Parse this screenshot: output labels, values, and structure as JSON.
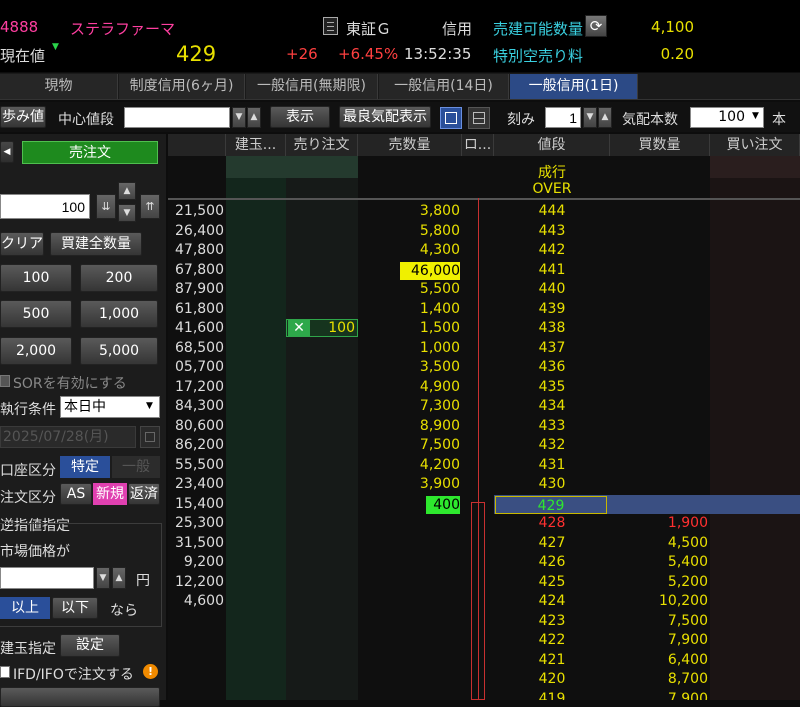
{
  "header": {
    "code": "4888",
    "name": "ステラファーマ",
    "price_label": "現在値",
    "price": "429",
    "change": "+26",
    "change_pct": "+6.45%",
    "time": "13:52:35",
    "market_icon_name": "document-icon",
    "market": "東証Ｇ",
    "margin": "信用",
    "sell_qty_label": "売建可能数量",
    "sell_qty": "4,100",
    "short_fee_label": "特別空売り料",
    "short_fee": "0.20"
  },
  "tabs": [
    "現物",
    "制度信用(6ヶ月)",
    "一般信用(無期限)",
    "一般信用(14日)",
    "一般信用(1日)"
  ],
  "controls": {
    "step_btn": "歩み値",
    "center_label": "中心値段",
    "center_value": "",
    "display_btn": "表示",
    "best_btn": "最良気配表示",
    "tick_label": "刻み",
    "tick_value": "1",
    "quote_label": "気配本数",
    "quote_value": "100",
    "quote_unit": "本"
  },
  "panel": {
    "sell_btn": "売注文",
    "qty": "100",
    "clear_btn": "クリア",
    "buy_all_btn": "買建全数量",
    "qty_buttons": [
      "100",
      "200",
      "500",
      "1,000",
      "2,000",
      "5,000"
    ],
    "sor_label": "SORを有効にする",
    "exec_label": "執行条件",
    "exec_value": "本日中",
    "date_value": "2025/07/28(月)",
    "account_label": "口座区分",
    "account_tokutei": "特定",
    "account_ippan": "一般",
    "order_label": "注文区分",
    "order_as": "AS",
    "order_new": "新規",
    "order_close": "返済",
    "stop_label": "逆指値指定",
    "market_price_label": "市場価格が",
    "yen": "円",
    "above_btn": "以上",
    "below_btn": "以下",
    "nara": "なら",
    "position_label": "建玉指定",
    "setting_btn": "設定",
    "ifd_label": "IFD/IFOで注文する",
    "warn_icon": "!"
  },
  "colors": {
    "accent": "#2c4a86",
    "sell_green": "#1e8a1e",
    "price_yellow": "#e8e000",
    "buy_red": "#e03030",
    "pink": "#ff3fa0"
  },
  "book": {
    "headers": [
      "建玉...",
      "売り注文",
      "売数量",
      "ロ...",
      "値段",
      "買数量",
      "買い注文"
    ],
    "nari": "成行",
    "over": "OVER",
    "ask_rows": [
      {
        "pos": "21,500",
        "qty": "3,800",
        "price": "444"
      },
      {
        "pos": "26,400",
        "qty": "5,800",
        "price": "443"
      },
      {
        "pos": "47,800",
        "qty": "4,300",
        "price": "442"
      },
      {
        "pos": "67,800",
        "qty": "46,000",
        "price": "441"
      },
      {
        "pos": "87,900",
        "qty": "5,500",
        "price": "440"
      },
      {
        "pos": "61,800",
        "qty": "1,400",
        "price": "439"
      },
      {
        "pos": "41,600",
        "qty": "1,500",
        "price": "438",
        "order": "100"
      },
      {
        "pos": "68,500",
        "qty": "1,000",
        "price": "437"
      },
      {
        "pos": "05,700",
        "qty": "3,500",
        "price": "436"
      },
      {
        "pos": "17,200",
        "qty": "4,900",
        "price": "435"
      },
      {
        "pos": "84,300",
        "qty": "7,300",
        "price": "434"
      },
      {
        "pos": "80,600",
        "qty": "8,900",
        "price": "433"
      },
      {
        "pos": "86,200",
        "qty": "7,500",
        "price": "432"
      },
      {
        "pos": "55,500",
        "qty": "4,200",
        "price": "431"
      },
      {
        "pos": "23,400",
        "qty": "3,900",
        "price": "430"
      },
      {
        "pos": "15,400",
        "qty": "400",
        "price": "429"
      }
    ],
    "bid_rows": [
      {
        "pos": "25,300",
        "price": "428",
        "qty": "1,900"
      },
      {
        "pos": "31,500",
        "price": "427",
        "qty": "4,500"
      },
      {
        "pos": "9,200",
        "price": "426",
        "qty": "5,400"
      },
      {
        "pos": "12,200",
        "price": "425",
        "qty": "5,200"
      },
      {
        "pos": "4,600",
        "price": "424",
        "qty": "10,200"
      },
      {
        "pos": "",
        "price": "423",
        "qty": "7,500"
      },
      {
        "pos": "",
        "price": "422",
        "qty": "7,900"
      },
      {
        "pos": "",
        "price": "421",
        "qty": "6,400"
      },
      {
        "pos": "",
        "price": "420",
        "qty": "8,700"
      },
      {
        "pos": "",
        "price": "419",
        "qty": "7,900"
      }
    ]
  }
}
